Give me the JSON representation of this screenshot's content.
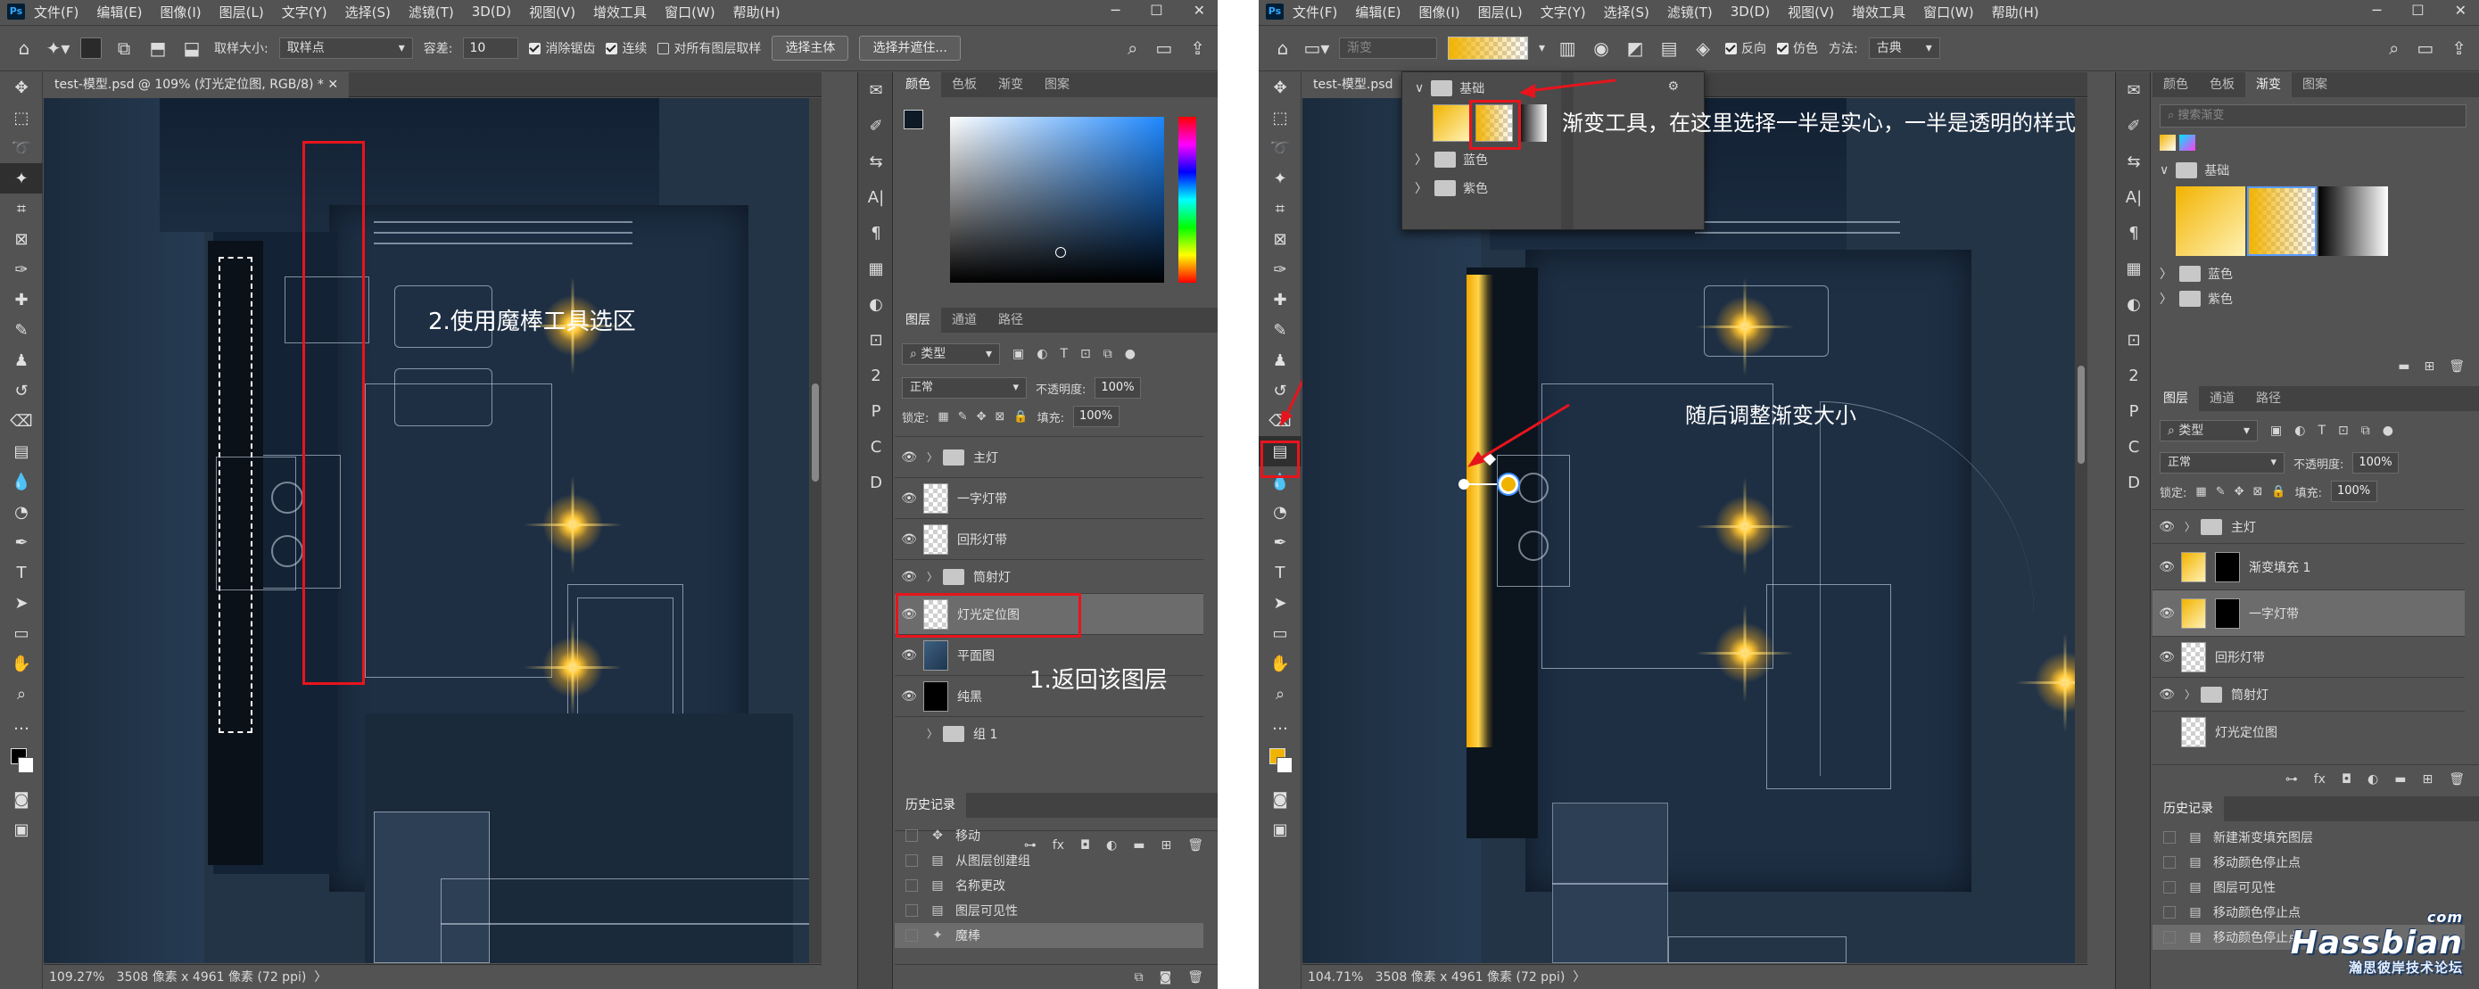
{
  "left": {
    "menu": [
      "文件(F)",
      "编辑(E)",
      "图像(I)",
      "图层(L)",
      "文字(Y)",
      "选择(S)",
      "滤镜(T)",
      "3D(D)",
      "视图(V)",
      "增效工具",
      "窗口(W)",
      "帮助(H)"
    ],
    "options": {
      "sample_label": "取样大小:",
      "sample_value": "取样点",
      "tolerance_label": "容差:",
      "tolerance_value": "10",
      "antialias": "消除锯齿",
      "contiguous": "连续",
      "all_layers": "对所有图层取样",
      "select_subject": "选择主体",
      "select_mask": "选择并遮住..."
    },
    "doc_tab": "test-模型.psd @ 109% (灯光定位图, RGB/8) *",
    "status": {
      "zoom": "109.27%",
      "doc_info": "3508 像素 x 4961 像素 (72 ppi)"
    },
    "panel_tabs_top": [
      "颜色",
      "色板",
      "渐变",
      "图案"
    ],
    "layers_tabs": [
      "图层",
      "通道",
      "路径"
    ],
    "filter_kind": "类型",
    "blend_mode": "正常",
    "opacity_label": "不透明度:",
    "opacity_value": "100%",
    "lock_label": "锁定:",
    "fill_label": "填充:",
    "fill_value": "100%",
    "layers": [
      {
        "name": "主灯",
        "kind": "folder"
      },
      {
        "name": "一字灯带",
        "kind": "pixel"
      },
      {
        "name": "回形灯带",
        "kind": "pixel"
      },
      {
        "name": "筒射灯",
        "kind": "folder"
      },
      {
        "name": "灯光定位图",
        "kind": "pixel",
        "selected": true
      },
      {
        "name": "平面图",
        "kind": "plan"
      },
      {
        "name": "纯黑",
        "kind": "dark"
      },
      {
        "name": "组 1",
        "kind": "folder",
        "hidden": true
      }
    ],
    "history_title": "历史记录",
    "history": [
      "移动",
      "从图层创建组",
      "名称更改",
      "图层可见性",
      "魔棒"
    ],
    "annotations": {
      "step1": "1.返回该图层",
      "step2": "2.使用魔棒工具选区"
    }
  },
  "right": {
    "menu": [
      "文件(F)",
      "编辑(E)",
      "图像(I)",
      "图层(L)",
      "文字(Y)",
      "选择(S)",
      "滤镜(T)",
      "3D(D)",
      "视图(V)",
      "增效工具",
      "窗口(W)",
      "帮助(H)"
    ],
    "options": {
      "gradient_label": "渐变",
      "reverse": "反向",
      "dither": "仿色",
      "method_label": "方法:",
      "method_value": "古典"
    },
    "doc_tab": "test-模型.psd",
    "status": {
      "zoom": "104.71%",
      "doc_info": "3508 像素 x 4961 像素 (72 ppi)"
    },
    "picker": {
      "group_basic": "基础",
      "group_blue": "蓝色",
      "group_purple": "紫色"
    },
    "panel_tabs_top": [
      "颜色",
      "色板",
      "渐变",
      "图案"
    ],
    "search_placeholder": "搜索渐变",
    "gradient_groups": [
      "基础",
      "蓝色",
      "紫色"
    ],
    "layers_tabs": [
      "图层",
      "通道",
      "路径"
    ],
    "filter_kind": "类型",
    "blend_mode": "正常",
    "opacity_label": "不透明度:",
    "opacity_value": "100%",
    "lock_label": "锁定:",
    "fill_label": "填充:",
    "fill_value": "100%",
    "layers": [
      {
        "name": "主灯",
        "kind": "folder"
      },
      {
        "name": "渐变填充 1",
        "kind": "grad"
      },
      {
        "name": "一字灯带",
        "kind": "grad",
        "selected": true
      },
      {
        "name": "回形灯带",
        "kind": "pixel"
      },
      {
        "name": "筒射灯",
        "kind": "folder"
      },
      {
        "name": "灯光定位图",
        "kind": "pixel",
        "hidden": true
      }
    ],
    "history_title": "历史记录",
    "history": [
      "新建渐变填充图层",
      "移动颜色停止点",
      "图层可见性",
      "移动颜色停止点",
      "移动颜色停止点"
    ],
    "annotations": {
      "gradient_tool": "渐变工具，在这里选择一半是实心，一半是透明的样式",
      "adjust": "随后调整渐变大小"
    },
    "watermark": {
      "brand": "Hassbian",
      "tld": "com",
      "sub": "瀚思彼岸技术论坛"
    }
  },
  "colors": {
    "ui_bg": "#535353",
    "panel_dark": "#424242",
    "canvas": "#243447",
    "annotation_red": "#e8141c",
    "highlight": "#f0b400"
  }
}
